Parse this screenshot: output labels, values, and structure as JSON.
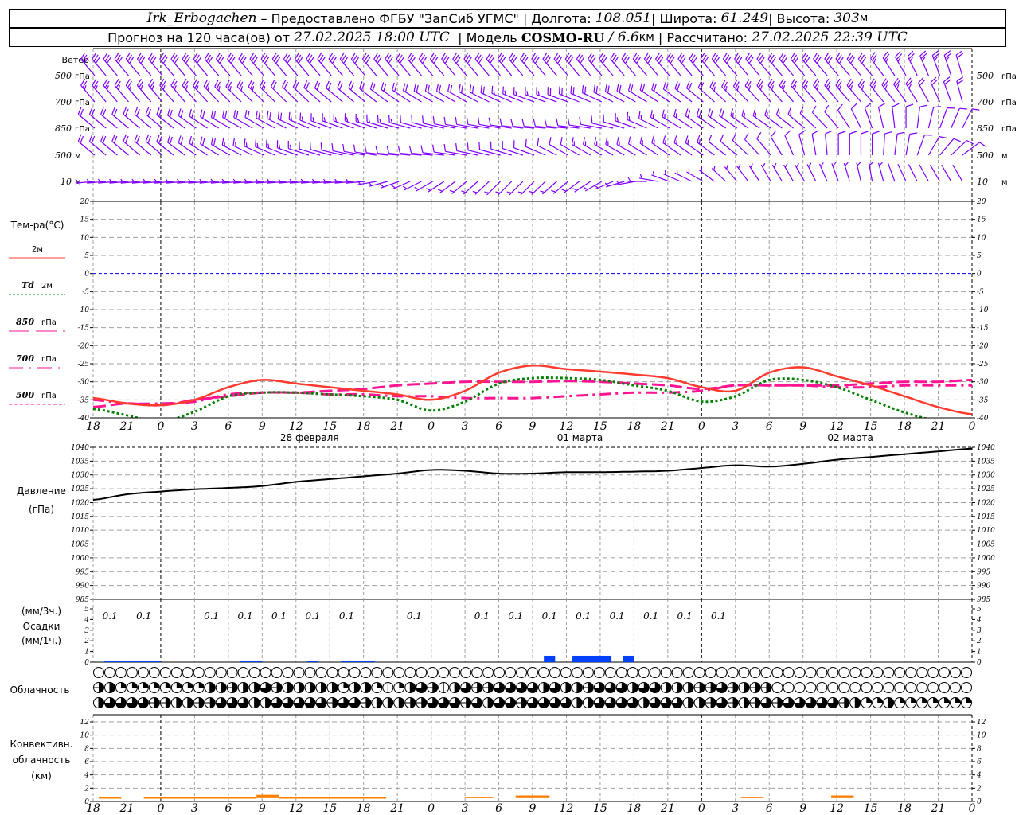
{
  "header": {
    "station": "Irk_Erbogachen",
    "provider": " – Предоставлено ФГБУ \"ЗапСиб УГМС\" ",
    "sep": "|",
    "lon_label": " Долгота: ",
    "lon_value": "108.051",
    "lat_label": " Широта: ",
    "lat_value": "61.249",
    "alt_label": " Высота: ",
    "alt_value": "303",
    "alt_unit": "м",
    "forecast_label": "Прогноз на 120 часа(ов) от ",
    "forecast_start": "27.02.2025 18:00 UTC",
    "model_label": " Модель ",
    "model_name": "COSMO-RU",
    "model_slash": " / ",
    "model_res": "6.6",
    "model_res_unit": "км",
    "computed_label": " Рассчитано: ",
    "computed_value": "27.02.2025 22:39 UTC"
  },
  "colors": {
    "wind": "#8000ff",
    "t2m": "#ff3b30",
    "td2m": "#008000",
    "levels": "#ff1493",
    "zero_line": "#0000ff",
    "pressure": "#000000",
    "precip": "#0040ff",
    "convective": "#ff8000",
    "grid": "#a0a0a0"
  },
  "time_axis": {
    "labels": [
      "18",
      "21",
      "0",
      "3",
      "6",
      "9",
      "12",
      "15",
      "18",
      "21",
      "0",
      "3",
      "6",
      "9",
      "12",
      "15",
      "18",
      "21",
      "0",
      "3",
      "6",
      "9",
      "12",
      "15",
      "18",
      "21",
      "0"
    ],
    "dates": [
      "28 февраля",
      "01 марта",
      "02 марта"
    ]
  },
  "wind": {
    "title": "Ветер",
    "levels": [
      {
        "label_num": "500",
        "label_unit": "гПа",
        "dir": [
          320,
          320,
          320,
          320,
          320,
          320,
          320,
          320,
          320,
          320,
          320,
          320,
          320,
          320,
          320,
          320,
          320,
          320,
          320,
          320,
          320,
          320,
          320,
          320,
          330,
          340,
          345
        ],
        "speed": [
          15,
          15,
          15,
          15,
          15,
          15,
          15,
          15,
          15,
          15,
          15,
          15,
          15,
          15,
          15,
          15,
          15,
          15,
          15,
          15,
          15,
          15,
          15,
          15,
          14,
          13,
          12
        ]
      },
      {
        "label_num": "700",
        "label_unit": "гПа",
        "dir": [
          320,
          320,
          320,
          320,
          315,
          315,
          315,
          310,
          310,
          305,
          300,
          300,
          295,
          290,
          290,
          295,
          300,
          305,
          310,
          315,
          320,
          320,
          320,
          320,
          325,
          335,
          350
        ],
        "speed": [
          14,
          14,
          14,
          14,
          14,
          13,
          12,
          12,
          12,
          11,
          10,
          10,
          10,
          9,
          10,
          10,
          10,
          11,
          12,
          13,
          14,
          14,
          14,
          14,
          13,
          12,
          12
        ]
      },
      {
        "label_num": "850",
        "label_unit": "гПа",
        "dir": [
          310,
          310,
          310,
          305,
          300,
          300,
          295,
          290,
          290,
          285,
          285,
          280,
          280,
          275,
          275,
          280,
          290,
          300,
          305,
          305,
          305,
          310,
          320,
          340,
          0,
          20,
          30
        ],
        "speed": [
          10,
          10,
          10,
          10,
          10,
          10,
          10,
          9,
          9,
          8,
          7,
          6,
          5,
          5,
          5,
          6,
          8,
          9,
          10,
          10,
          9,
          8,
          6,
          6,
          6,
          6,
          6
        ]
      },
      {
        "label_num": "500",
        "label_unit": "м",
        "dir": [
          310,
          310,
          310,
          305,
          300,
          295,
          290,
          285,
          280,
          275,
          275,
          280,
          285,
          290,
          300,
          300,
          300,
          305,
          305,
          310,
          320,
          345,
          0,
          0,
          10,
          40,
          60
        ],
        "speed": [
          10,
          10,
          10,
          10,
          10,
          9,
          8,
          7,
          7,
          6,
          6,
          6,
          6,
          6,
          7,
          8,
          8,
          8,
          8,
          7,
          6,
          5,
          5,
          5,
          5,
          5,
          5
        ]
      },
      {
        "label_num": "10",
        "label_unit": "м",
        "dir": [
          265,
          265,
          265,
          265,
          265,
          265,
          265,
          265,
          265,
          250,
          240,
          230,
          225,
          225,
          230,
          240,
          260,
          290,
          300,
          320,
          330,
          330,
          340,
          350,
          335,
          330,
          330
        ],
        "speed": [
          4,
          4,
          4,
          4,
          4,
          4,
          4,
          4,
          4,
          3,
          3,
          3,
          3,
          3,
          3,
          3,
          3,
          3,
          3,
          3,
          3,
          3,
          3,
          3,
          2,
          2,
          2
        ]
      }
    ]
  },
  "temperature": {
    "title": "Тем-ра(°C)",
    "legend": {
      "t2m": {
        "num": "",
        "unit": "2м"
      },
      "td2m": {
        "num": "Td",
        "unit": "2м"
      },
      "t850": {
        "num": "850",
        "unit": "гПа"
      },
      "t700": {
        "num": "700",
        "unit": "гПа"
      },
      "t500": {
        "num": "500",
        "unit": "гПа"
      }
    }
  },
  "pressure": {
    "title": "Давление",
    "unit": "(гПа)"
  },
  "precip": {
    "unit3h": "(мм/3ч.)",
    "title": "Осадки",
    "unit1h": "(мм/1ч.)"
  },
  "clouds": {
    "title": "Облачность"
  },
  "convective": {
    "title1": "Конвективн.",
    "title2": "облачность",
    "unit": "(км)"
  },
  "chart_data": [
    {
      "type": "line",
      "title": "Тем-ра(°C)",
      "x_start": "27.02.2025 18:00 UTC",
      "x_step_hours": 3,
      "ylim": [
        -40,
        20
      ],
      "yticks": [
        20,
        15,
        10,
        5,
        0,
        -5,
        -10,
        -15,
        -20,
        -25,
        -30,
        -35,
        -40
      ],
      "grid": true,
      "series": [
        {
          "name": "2м",
          "key": "t2m",
          "values": [
            -34.5,
            -36,
            -36.5,
            -35,
            -31.5,
            -29.5,
            -30.5,
            -31.5,
            -32.5,
            -33.5,
            -35,
            -32.5,
            -27.5,
            -25.5,
            -26.5,
            -27.2,
            -28,
            -29,
            -31.5,
            -32.5,
            -27.5,
            -26,
            -28.5,
            -31,
            -34,
            -37,
            -39
          ]
        },
        {
          "name": "Td 2м",
          "key": "td2m",
          "values": [
            -37.5,
            -39.3,
            -41,
            -38.3,
            -34,
            -33,
            -33,
            -33.5,
            -34,
            -35,
            -38,
            -35.5,
            -30.5,
            -29,
            -29,
            -29.5,
            -31,
            -32.5,
            -35.5,
            -34,
            -29.5,
            -29.5,
            -31.5,
            -35,
            -38.5,
            -41,
            -43
          ]
        },
        {
          "name": "850 гПа",
          "key": "t850",
          "values": [
            -37,
            -36,
            -36.5,
            -35,
            -34,
            -33,
            -33,
            -32.5,
            -32,
            -31,
            -30.5,
            -30,
            -30,
            -30,
            -29.8,
            -30,
            -30.5,
            -31,
            -32,
            -31,
            -31,
            -31,
            -31,
            -30.5,
            -30,
            -30,
            -29.5
          ]
        },
        {
          "name": "700 гПа",
          "key": "t700",
          "values": [
            -35,
            -36,
            -36,
            -35.5,
            -33.5,
            -33,
            -33,
            -33.5,
            -33.5,
            -34,
            -34,
            -34.5,
            -34.5,
            -34.5,
            -34,
            -33.5,
            -33,
            -33,
            -32.5,
            -31,
            -31,
            -31,
            -31.5,
            -31.5,
            -31,
            -31,
            -31
          ]
        }
      ]
    },
    {
      "type": "line",
      "title": "Давление",
      "x_start": "27.02.2025 18:00 UTC",
      "x_step_hours": 3,
      "ylim": [
        985,
        1040
      ],
      "yticks": [
        1040,
        1035,
        1030,
        1025,
        1020,
        1015,
        1010,
        1005,
        1000,
        995,
        990,
        985
      ],
      "grid": true,
      "series": [
        {
          "name": "Давление",
          "values": [
            1021,
            1023,
            1024,
            1024.8,
            1025.3,
            1026,
            1027.5,
            1028.5,
            1029.5,
            1030.5,
            1031.8,
            1031.5,
            1030.5,
            1030.5,
            1031,
            1031,
            1031.2,
            1031.5,
            1032.5,
            1033.5,
            1033,
            1034,
            1035.5,
            1036.5,
            1037.5,
            1038.5,
            1039.5
          ]
        }
      ]
    },
    {
      "type": "bar",
      "title": "Осадки",
      "ylim": [
        0,
        5
      ],
      "yticks": [
        5,
        4,
        3,
        2,
        1,
        0
      ],
      "labels_3h": [
        "0.1",
        "0.1",
        "",
        "0.1",
        "0.1",
        "0.1",
        "0.1",
        "0.1",
        "",
        "0.1",
        "",
        "0.1",
        "0.1",
        "0.1",
        "0.1",
        "0.1",
        "0.1",
        "0.1",
        "0.1",
        "",
        "",
        "",
        "",
        "",
        "",
        ""
      ],
      "hourly_segments": [
        [
          1,
          6,
          0.02
        ],
        [
          13,
          15,
          0.02
        ],
        [
          19,
          20,
          0.02
        ],
        [
          22,
          25,
          0.02
        ],
        [
          40,
          41,
          0.1
        ],
        [
          42.5,
          46,
          0.1
        ],
        [
          47,
          48,
          0.1
        ]
      ]
    },
    {
      "type": "table",
      "title": "Облачность",
      "note_octas_hourly": "rows: high, middle, low",
      "high": [
        0,
        0,
        0,
        0,
        0,
        0,
        0,
        0,
        0,
        0,
        0,
        0,
        0,
        0,
        0,
        0,
        0,
        0,
        0,
        0,
        0,
        0,
        0,
        0,
        0,
        0,
        0,
        0,
        0,
        0,
        0,
        0,
        0,
        0,
        0,
        0,
        0,
        0,
        0,
        0,
        0,
        0,
        0,
        0,
        0,
        0,
        0,
        0,
        0,
        0,
        0,
        0,
        0,
        0,
        0,
        0,
        0,
        0,
        0,
        0,
        0,
        0,
        0,
        0,
        0,
        0,
        0,
        0,
        0,
        0,
        0,
        0,
        0,
        0,
        0,
        0,
        0,
        0,
        0
      ],
      "middle": [
        5,
        4,
        2,
        2,
        2,
        2,
        2,
        2,
        2,
        2,
        4,
        4,
        5,
        4,
        4,
        6,
        5,
        4,
        4,
        4,
        4,
        4,
        2,
        4,
        4,
        2,
        1,
        2,
        4,
        6,
        5,
        1,
        4,
        6,
        5,
        5,
        6,
        6,
        6,
        6,
        4,
        6,
        4,
        4,
        5,
        6,
        6,
        6,
        4,
        6,
        6,
        4,
        4,
        4,
        5,
        5,
        6,
        5,
        4,
        5,
        5,
        0,
        0,
        0,
        0,
        0,
        0,
        0,
        0,
        0,
        0,
        0,
        0,
        0,
        0,
        0,
        0,
        0,
        0
      ],
      "low": [
        4,
        6,
        6,
        6,
        6,
        5,
        5,
        4,
        4,
        5,
        5,
        7,
        6,
        6,
        4,
        4,
        6,
        6,
        6,
        6,
        6,
        5,
        6,
        6,
        5,
        4,
        4,
        4,
        5,
        5,
        6,
        6,
        6,
        5,
        6,
        4,
        6,
        6,
        5,
        6,
        6,
        6,
        6,
        4,
        4,
        6,
        6,
        6,
        6,
        4,
        6,
        6,
        6,
        4,
        4,
        5,
        6,
        5,
        4,
        5,
        6,
        5,
        6,
        6,
        6,
        6,
        6,
        5,
        4,
        2,
        2,
        4,
        2,
        2,
        2,
        2,
        2,
        2,
        2
      ]
    },
    {
      "type": "bar",
      "title": "Конвективн. облачность (км)",
      "ylim": [
        0,
        13
      ],
      "yticks": [
        12,
        10,
        8,
        6,
        4,
        2,
        0
      ],
      "grid": true,
      "segments_hours_km": [
        [
          0.5,
          2.5,
          0.6
        ],
        [
          4.5,
          14.5,
          0.6
        ],
        [
          14.5,
          16.5,
          1.0
        ],
        [
          16.5,
          26,
          0.6
        ],
        [
          33,
          35.5,
          0.7
        ],
        [
          37.5,
          40.5,
          0.9
        ],
        [
          57.5,
          59.5,
          0.7
        ],
        [
          65.5,
          67.5,
          0.9
        ]
      ]
    }
  ]
}
